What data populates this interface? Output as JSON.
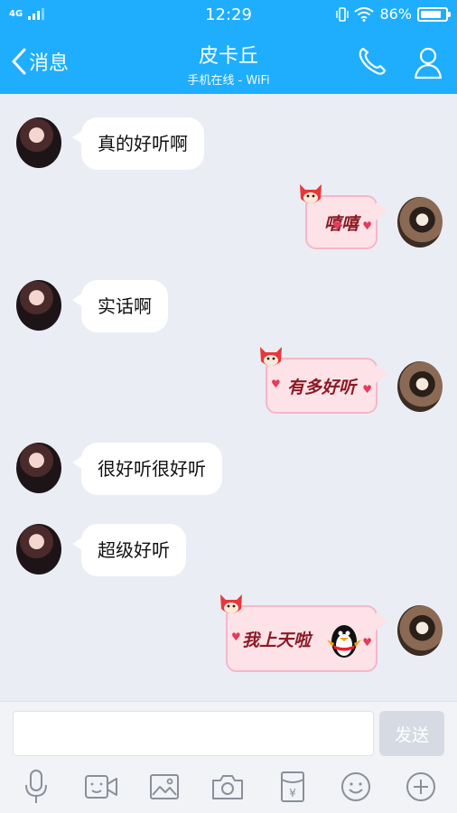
{
  "status_bar": {
    "network": "4G",
    "time": "12:29",
    "battery": "86%",
    "battery_level": 0.86
  },
  "header": {
    "back_label": "消息",
    "title": "皮卡丘",
    "subtitle": "手机在线 - WiFi"
  },
  "messages": [
    {
      "side": "left",
      "text": "真的好听啊"
    },
    {
      "side": "right",
      "sticker_text": "嘻嘻"
    },
    {
      "side": "left",
      "text": "实话啊"
    },
    {
      "side": "right",
      "sticker_text": "有多好听"
    },
    {
      "side": "left",
      "text": "很好听很好听"
    },
    {
      "side": "left",
      "text": "超级好听"
    },
    {
      "side": "right",
      "sticker_text": "我上天啦"
    }
  ],
  "input": {
    "value": "",
    "send_label": "发送"
  },
  "toolbar": {
    "icons": [
      "microphone-icon",
      "video-icon",
      "image-icon",
      "camera-icon",
      "red-packet-icon",
      "emoji-icon",
      "plus-icon"
    ],
    "red_packet_symbol": "¥"
  },
  "colors": {
    "accent": "#1eaefd",
    "chat_bg": "#eaedf4",
    "sticker_bg": "#fde2e8"
  }
}
